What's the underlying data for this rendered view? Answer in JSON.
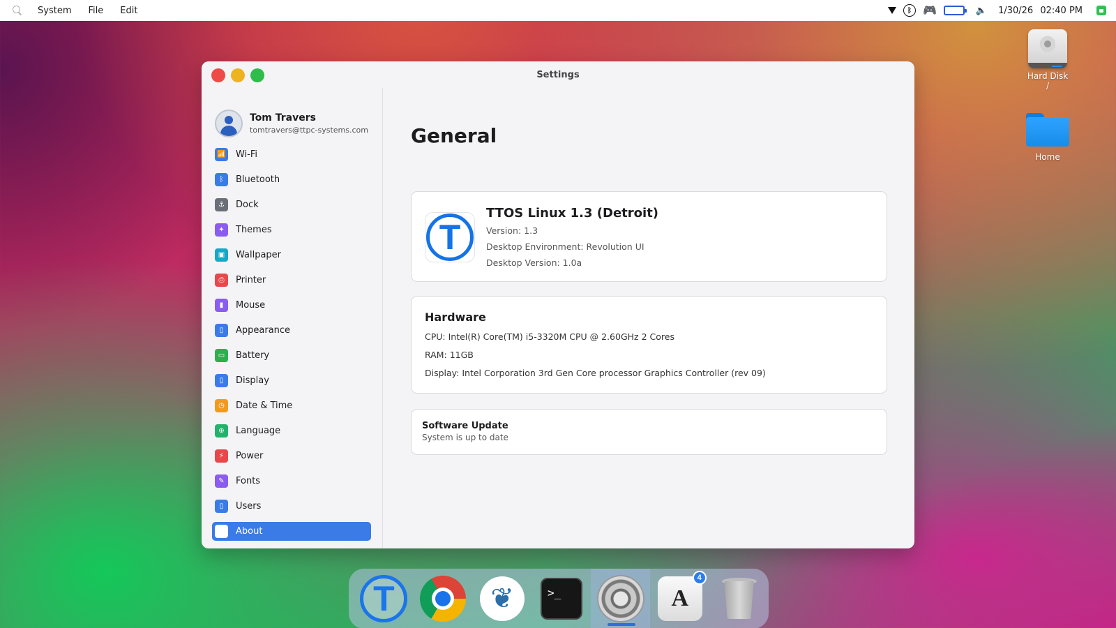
{
  "menubar": {
    "menus": [
      "System",
      "File",
      "Edit"
    ],
    "tray_icons": [
      "wifi-icon",
      "bluetooth-icon",
      "gamepad-icon",
      "battery-icon",
      "volume-icon"
    ],
    "date": "1/30/26",
    "time": "02:40 PM"
  },
  "desktop": {
    "icons": [
      {
        "label": "Hard Disk",
        "sublabel": "/",
        "icon": "hard-disk-icon"
      },
      {
        "label": "Home",
        "icon": "folder-icon"
      }
    ]
  },
  "window": {
    "title": "Settings",
    "profile": {
      "name": "Tom Travers",
      "email": "tomtravers@ttpc-systems.com"
    },
    "sidebar": {
      "items": [
        {
          "label": "Wi-Fi",
          "color": "#3a7be8",
          "glyph": "📶"
        },
        {
          "label": "Bluetooth",
          "color": "#3a7be8",
          "glyph": "ᛒ"
        },
        {
          "label": "Dock",
          "color": "#6b6f78",
          "glyph": "⚓"
        },
        {
          "label": "Themes",
          "color": "#8a5cf0",
          "glyph": "✦"
        },
        {
          "label": "Wallpaper",
          "color": "#17a7c7",
          "glyph": "▣"
        },
        {
          "label": "Printer",
          "color": "#e9484b",
          "glyph": "⎙"
        },
        {
          "label": "Mouse",
          "color": "#8a5cf0",
          "glyph": "▮"
        },
        {
          "label": "Appearance",
          "color": "#3a7be8",
          "glyph": "▯"
        },
        {
          "label": "Battery",
          "color": "#27b14f",
          "glyph": "▭"
        },
        {
          "label": "Display",
          "color": "#3a7be8",
          "glyph": "▯"
        },
        {
          "label": "Date & Time",
          "color": "#f29a1f",
          "glyph": "◷"
        },
        {
          "label": "Language",
          "color": "#21b36b",
          "glyph": "⊕"
        },
        {
          "label": "Power",
          "color": "#e9484b",
          "glyph": "⚡"
        },
        {
          "label": "Fonts",
          "color": "#8a5cf0",
          "glyph": "✎"
        },
        {
          "label": "Users",
          "color": "#3a7be8",
          "glyph": "▯"
        },
        {
          "label": "About",
          "color": "#ffffff",
          "glyph": "",
          "active": true
        }
      ]
    },
    "content": {
      "title": "General",
      "os": {
        "logo_letter": "T",
        "name": "TTOS Linux 1.3 (Detroit)",
        "version": "Version: 1.3",
        "desktop_env": "Desktop Environment: Revolution UI",
        "desktop_version": "Desktop Version: 1.0a"
      },
      "hardware": {
        "title": "Hardware",
        "cpu": "CPU: Intel(R) Core(TM) i5-3320M CPU @ 2.60GHz 2 Cores",
        "ram": "RAM: 11GB",
        "display": "Display: Intel Corporation 3rd Gen Core processor Graphics Controller (rev 09)"
      },
      "software_update": {
        "title": "Software Update",
        "status": "System is up to date"
      }
    }
  },
  "dock": {
    "apps": [
      {
        "name": "ttos-app-icon",
        "glyph": "T"
      },
      {
        "name": "chrome-icon"
      },
      {
        "name": "coral-app-icon",
        "glyph": "❦"
      },
      {
        "name": "terminal-icon",
        "glyph": ">_"
      },
      {
        "name": "settings-icon",
        "running": true
      },
      {
        "name": "app-store-icon",
        "glyph": "A",
        "badge": "4"
      },
      {
        "name": "trash-icon"
      }
    ]
  }
}
